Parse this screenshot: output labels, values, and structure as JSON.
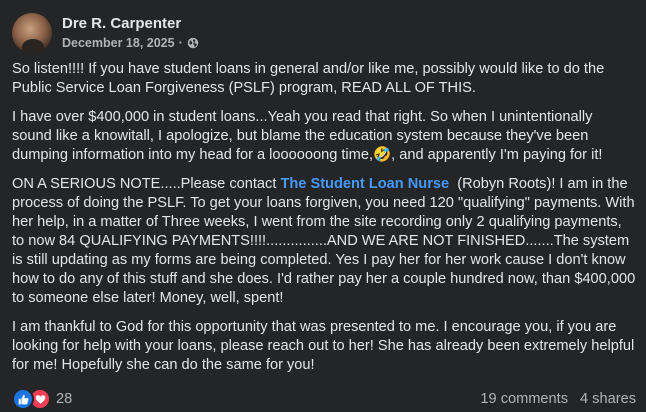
{
  "post": {
    "author": "Dre R. Carpenter",
    "date": "December 18, 2025",
    "separator": "·",
    "privacy_icon": "globe-icon",
    "paragraphs": {
      "p1": "So listen!!!! If you have student loans in general and/or like me, possibly would like to do the Public Service Loan Forgiveness (PSLF) program, READ ALL OF THIS.",
      "p2": "I have over $400,000 in student loans...Yeah you read that right. So when I unintentionally sound like a knowitall, I apologize, but blame the education system because they've been dumping information into my head for a loooooong time,🤣, and apparently I'm paying for it!",
      "p3_before": "ON A SERIOUS NOTE.....Please contact ",
      "p3_mention": "The Student Loan Nurse",
      "p3_after": "  (Robyn Roots)! I am in the process of doing the PSLF. To get your loans forgiven, you need 120 \"qualifying\" payments. With her help, in a matter of Three weeks, I went from the site recording only 2 qualifying payments, to now 84 QUALIFYING PAYMENTS!!!!...............AND WE ARE NOT FINISHED.......The system is still updating as my forms are being completed. Yes I pay her for her work cause I don't know how to do any of this stuff and she does. I'd rather pay her a couple hundred now, than $400,000 to someone else later! Money, well, spent!",
      "p4": "I am thankful to God for this opportunity that was presented to me. I encourage you, if you are looking for help with your loans, please reach out to her! She has already been extremely helpful for me! Hopefully she can do the same for you!"
    }
  },
  "footer": {
    "reaction_icons": [
      "like-icon",
      "love-icon"
    ],
    "reaction_count": "28",
    "comments": "19 comments",
    "shares": "4 shares"
  },
  "colors": {
    "background": "#242526",
    "text": "#e4e6eb",
    "secondary": "#b0b3b8",
    "mention": "#4599ff",
    "like": "#1b74e4",
    "love": "#f33e58"
  }
}
